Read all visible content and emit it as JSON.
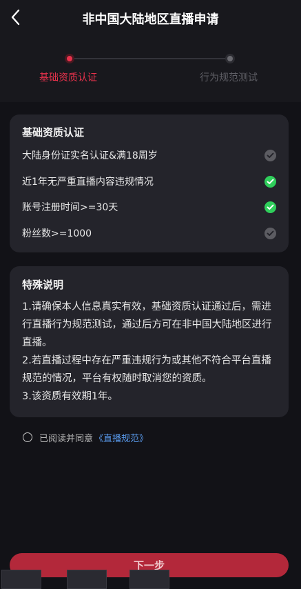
{
  "header": {
    "title": "非中国大陆地区直播申请",
    "back_icon": "chevron-left-icon"
  },
  "steps": [
    {
      "label": "基础资质认证",
      "active": true
    },
    {
      "label": "行为规范测试",
      "active": false
    }
  ],
  "qualification": {
    "title": "基础资质认证",
    "conditions": [
      {
        "text": "大陆身份证实名认证&满18周岁",
        "met": false
      },
      {
        "text": "近1年无严重直播内容违规情况",
        "met": true
      },
      {
        "text": "账号注册时间>=30天",
        "met": true
      },
      {
        "text": "粉丝数>=1000",
        "met": false
      }
    ]
  },
  "notes": {
    "title": "特殊说明",
    "body": "1.请确保本人信息真实有效，基础资质认证通过后，需进行直播行为规范测试，通过后方可在非中国大陆地区进行直播。\n2.若直播过程中存在严重违规行为或其他不符合平台直播规范的情况，平台有权随时取消您的资质。\n3.该资质有效期1年。"
  },
  "agreement": {
    "text": "已阅读并同意",
    "link": "《直播规范》"
  },
  "next_button": "下一步",
  "colors": {
    "accent": "#e8324c",
    "check_met": "#2fce5b",
    "check_unmet": "#5c5c62",
    "link": "#5a9cf0"
  }
}
